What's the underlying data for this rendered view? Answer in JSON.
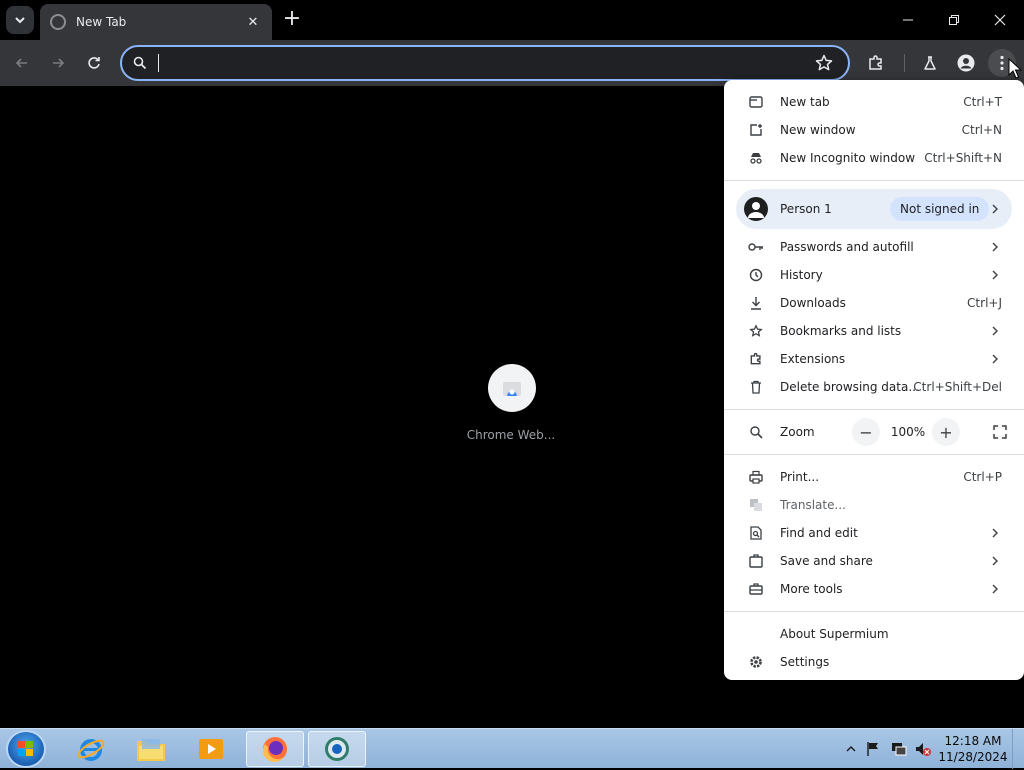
{
  "tab": {
    "title": "New Tab"
  },
  "omnibox": {
    "value": "",
    "placeholder": ""
  },
  "content": {
    "shortcut_label": "Chrome Web..."
  },
  "menu": {
    "new_tab": {
      "label": "New tab",
      "shortcut": "Ctrl+T"
    },
    "new_window": {
      "label": "New window",
      "shortcut": "Ctrl+N"
    },
    "new_incognito": {
      "label": "New Incognito window",
      "shortcut": "Ctrl+Shift+N"
    },
    "profile": {
      "name": "Person 1",
      "status": "Not signed in"
    },
    "passwords": {
      "label": "Passwords and autofill"
    },
    "history": {
      "label": "History"
    },
    "downloads": {
      "label": "Downloads",
      "shortcut": "Ctrl+J"
    },
    "bookmarks": {
      "label": "Bookmarks and lists"
    },
    "extensions": {
      "label": "Extensions"
    },
    "delete_data": {
      "label": "Delete browsing data...",
      "shortcut": "Ctrl+Shift+Del"
    },
    "zoom": {
      "label": "Zoom",
      "level": "100%",
      "minus": "−",
      "plus": "+"
    },
    "print": {
      "label": "Print...",
      "shortcut": "Ctrl+P"
    },
    "translate": {
      "label": "Translate..."
    },
    "find_edit": {
      "label": "Find and edit"
    },
    "save_share": {
      "label": "Save and share"
    },
    "more_tools": {
      "label": "More tools"
    },
    "about": {
      "label": "About Supermium"
    },
    "settings": {
      "label": "Settings"
    }
  },
  "taskbar": {
    "time": "12:18 AM",
    "date": "11/28/2024"
  },
  "colors": {
    "accent": "#8ab4f8",
    "toolbar": "#35363a",
    "menu_bg": "#ffffff",
    "profile_bg": "#e8eef7"
  }
}
